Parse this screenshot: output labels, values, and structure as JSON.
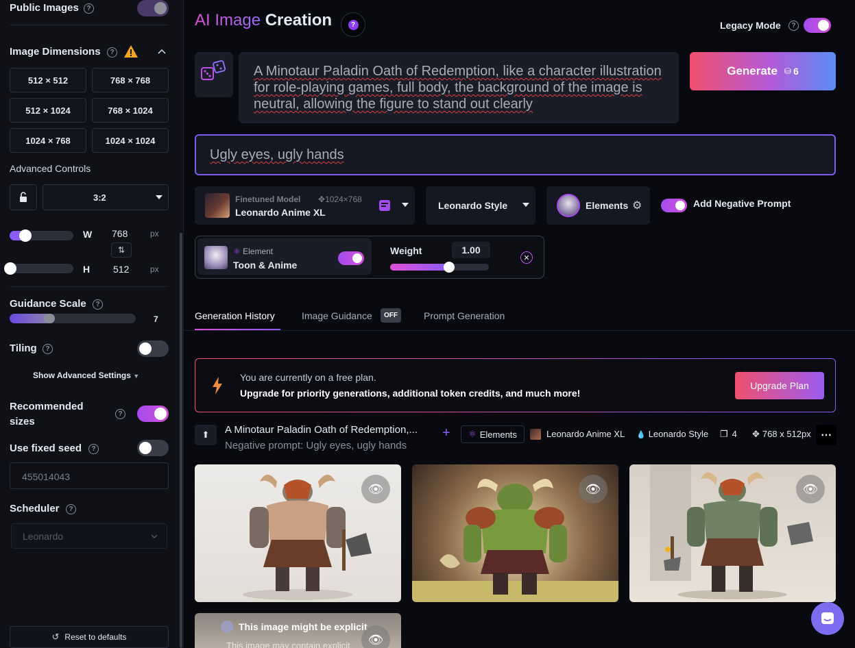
{
  "sidebar": {
    "public_images": "Public Images",
    "image_dimensions": "Image Dimensions",
    "dims": [
      "512 × 512",
      "768 × 768",
      "512 × 1024",
      "768 × 1024",
      "1024 × 768",
      "1024 × 1024"
    ],
    "advanced_controls": "Advanced Controls",
    "aspect_ratio": "3:2",
    "w_label": "W",
    "w_value": "768",
    "h_label": "H",
    "h_value": "512",
    "px": "px",
    "guidance_scale": "Guidance Scale",
    "guidance_value": "7",
    "tiling": "Tiling",
    "show_advanced": "Show Advanced Settings",
    "recommended_sizes": "Recommended sizes",
    "fixed_seed": "Use fixed seed",
    "seed_value": "455014043",
    "scheduler": "Scheduler",
    "scheduler_value": "Leonardo",
    "reset": "Reset to defaults"
  },
  "header": {
    "title_accent": "AI Image",
    "title_rest": "Creation",
    "legacy_mode": "Legacy Mode"
  },
  "prompt": {
    "text": "A Minotaur Paladin Oath of Redemption, like a character illustration for role-playing games, full body, the background of the image is neutral, allowing the figure to stand out clearly",
    "negative": "Ugly eyes, ugly hands"
  },
  "generate": {
    "label": "Generate",
    "cost": "6"
  },
  "model": {
    "caption": "Finetuned Model",
    "name": "Leonardo Anime XL",
    "size": "1024×768"
  },
  "style": {
    "label": "Leonardo Style"
  },
  "elements": {
    "label": "Elements"
  },
  "negative_toggle": {
    "label": "Add Negative Prompt"
  },
  "element_card": {
    "caption": "Element",
    "name": "Toon & Anime",
    "weight_label": "Weight",
    "weight_value": "1.00",
    "weight_fraction": 0.6
  },
  "tabs": {
    "history": "Generation History",
    "guidance": "Image Guidance",
    "guidance_badge": "OFF",
    "prompt_gen": "Prompt Generation"
  },
  "banner": {
    "line1": "You are currently on a free plan.",
    "line2": "Upgrade for priority generations, additional token credits, and much more!",
    "button": "Upgrade Plan"
  },
  "generation": {
    "prompt": "A Minotaur Paladin Oath of Redemption,...",
    "negative": "Negative prompt: Ugly eyes, ugly hands",
    "elements": "Elements",
    "model": "Leonardo Anime XL",
    "style": "Leonardo Style",
    "count": "4",
    "size": "768 x 512px"
  },
  "explicit": {
    "title": "This image might be explicit",
    "subtitle": "This image may contain explicit"
  },
  "colors": {
    "accent": "#a34cf0",
    "generate_start": "#f0506e",
    "generate_end": "#5b8cf7"
  }
}
